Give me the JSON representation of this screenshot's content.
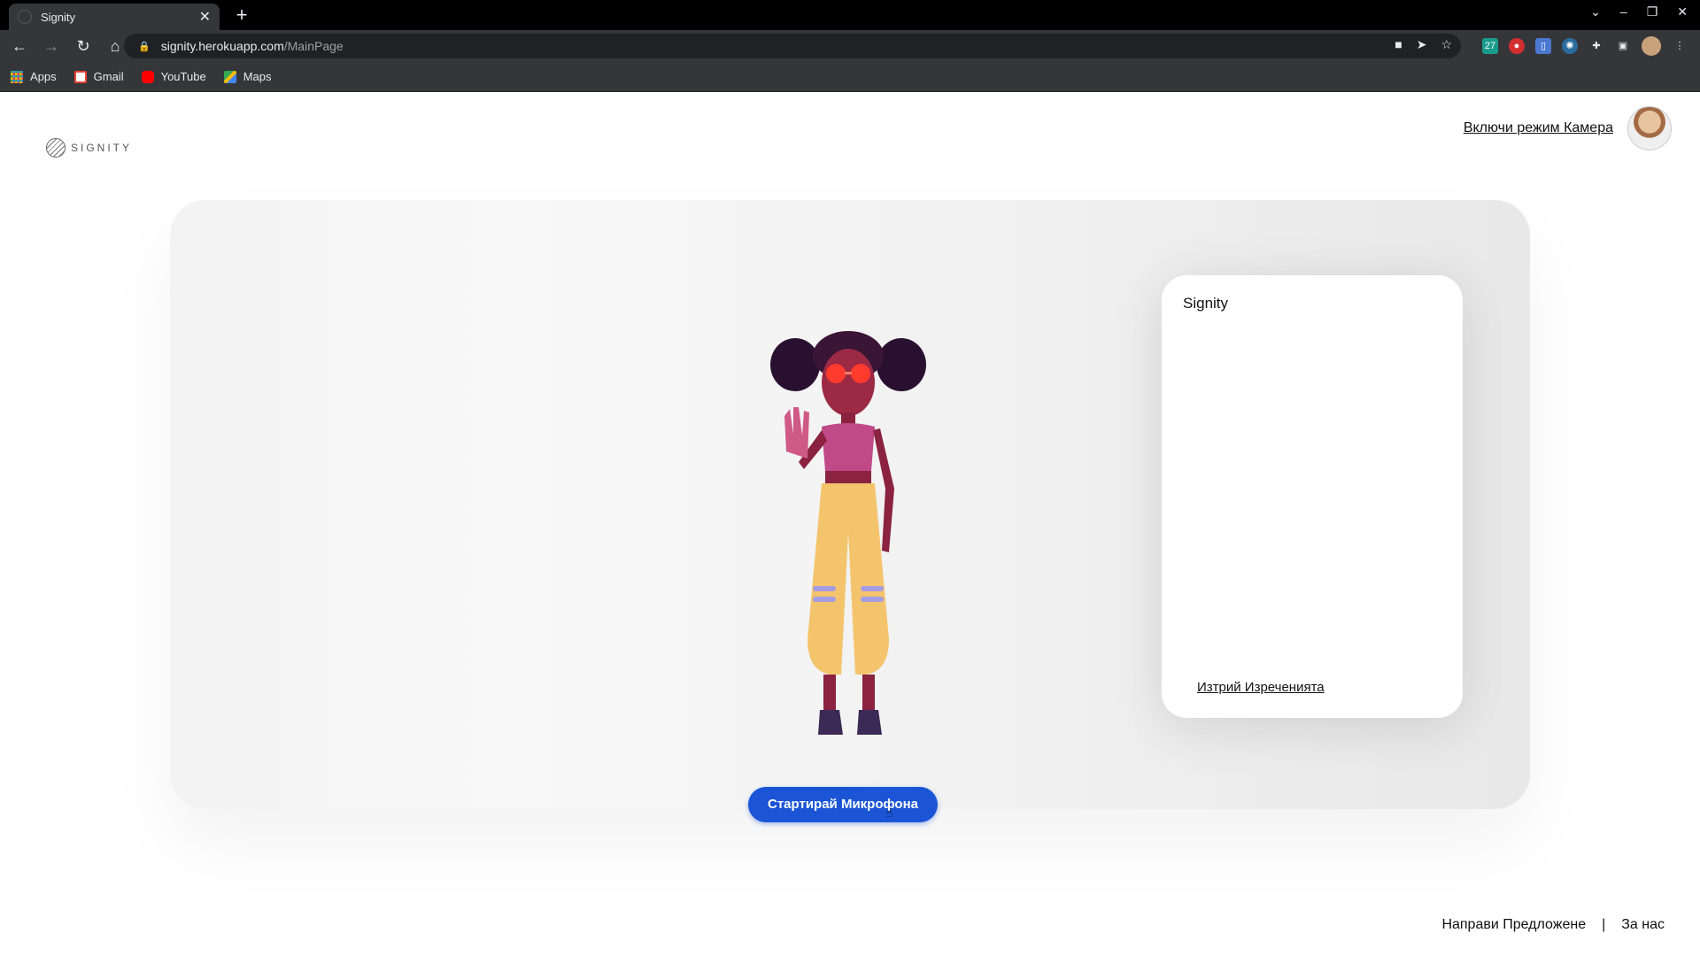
{
  "browser": {
    "tab_title": "Signity",
    "url_host": "signity.herokuapp.com",
    "url_path": "/MainPage",
    "bookmarks": [
      {
        "label": "Apps",
        "icon": "apps-grid-icon"
      },
      {
        "label": "Gmail",
        "icon": "gmail-icon"
      },
      {
        "label": "YouTube",
        "icon": "youtube-icon"
      },
      {
        "label": "Maps",
        "icon": "maps-icon"
      }
    ]
  },
  "header": {
    "logo_text": "SIGNITY",
    "camera_mode_link": "Включи режим Камера"
  },
  "chat": {
    "title": "Signity",
    "delete_link": "Изтрий Изреченията"
  },
  "controls": {
    "mic_button": "Стартирай Микрофона"
  },
  "footer": {
    "suggest_link": "Направи Предложене",
    "separator": "|",
    "about_link": "За нас"
  },
  "colors": {
    "accent": "#1b55d6",
    "browser_dark": "#35363a"
  }
}
